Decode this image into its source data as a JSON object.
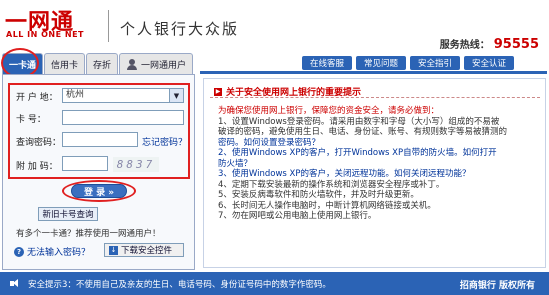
{
  "header": {
    "logo_cn": "一网通",
    "logo_en": "ALL IN ONE NET",
    "title": "个人银行大众版",
    "hotline_label": "服务热线：",
    "hotline_number": "95555"
  },
  "left_tabs": [
    "一卡通",
    "信用卡",
    "存折",
    "一网通用户"
  ],
  "login": {
    "region_label": "开 户 地：",
    "region_value": "杭州",
    "card_label": "卡    号：",
    "password_label": "查询密码：",
    "forgot_label": "忘记密码？",
    "captcha_label": "附 加 码：",
    "captcha_text": "8837",
    "login_button": "登 录 »",
    "new_card_button": "新旧卡号查询",
    "hint": "有多个一卡通？推荐使用一网通用户！",
    "cant_input": "无法输入密码？",
    "download_button": "下载安全控件"
  },
  "right_nav": [
    "在线客服",
    "常见问题",
    "安全指引",
    "安全认证"
  ],
  "notice": {
    "title": "关于安全使用网上银行的重要提示",
    "lines": [
      {
        "text": "为确保您使用网上银行，保障您的资金安全，请务必做到：",
        "style": "red"
      },
      {
        "text": "1、设置Windows登录密码。请采用由数字和字母（大小写）组成的不易被",
        "style": ""
      },
      {
        "text": "破译的密码，避免使用生日、电话、身份证、账号、有规则数字等易被猜测的",
        "style": ""
      },
      {
        "text": "密码。如何设置登录密码？",
        "style": "blue"
      },
      {
        "text": "2、使用Windows XP的客户，打开Windows XP自带的防火墙。如何打开",
        "style": "blue"
      },
      {
        "text": "防火墙？",
        "style": "blue"
      },
      {
        "text": "3、使用Windows XP的客户，关闭远程功能。如何关闭远程功能？",
        "style": "blue"
      },
      {
        "text": "4、定期下载安装最新的操作系统和浏览器安全程序或补丁。",
        "style": ""
      },
      {
        "text": "5、安装反病毒软件和防火墙软件，并及时升级更新。",
        "style": ""
      },
      {
        "text": "6、长时间无人操作电脑时，中断计算机网络链接或关机。",
        "style": ""
      },
      {
        "text": "7、勿在网吧或公用电脑上使用网上银行。",
        "style": ""
      }
    ]
  },
  "footer": {
    "tip": "安全提示3：不使用自己及亲友的生日、电话号码、身份证号码中的数字作密码。",
    "right": "招商银行  版权所有"
  }
}
